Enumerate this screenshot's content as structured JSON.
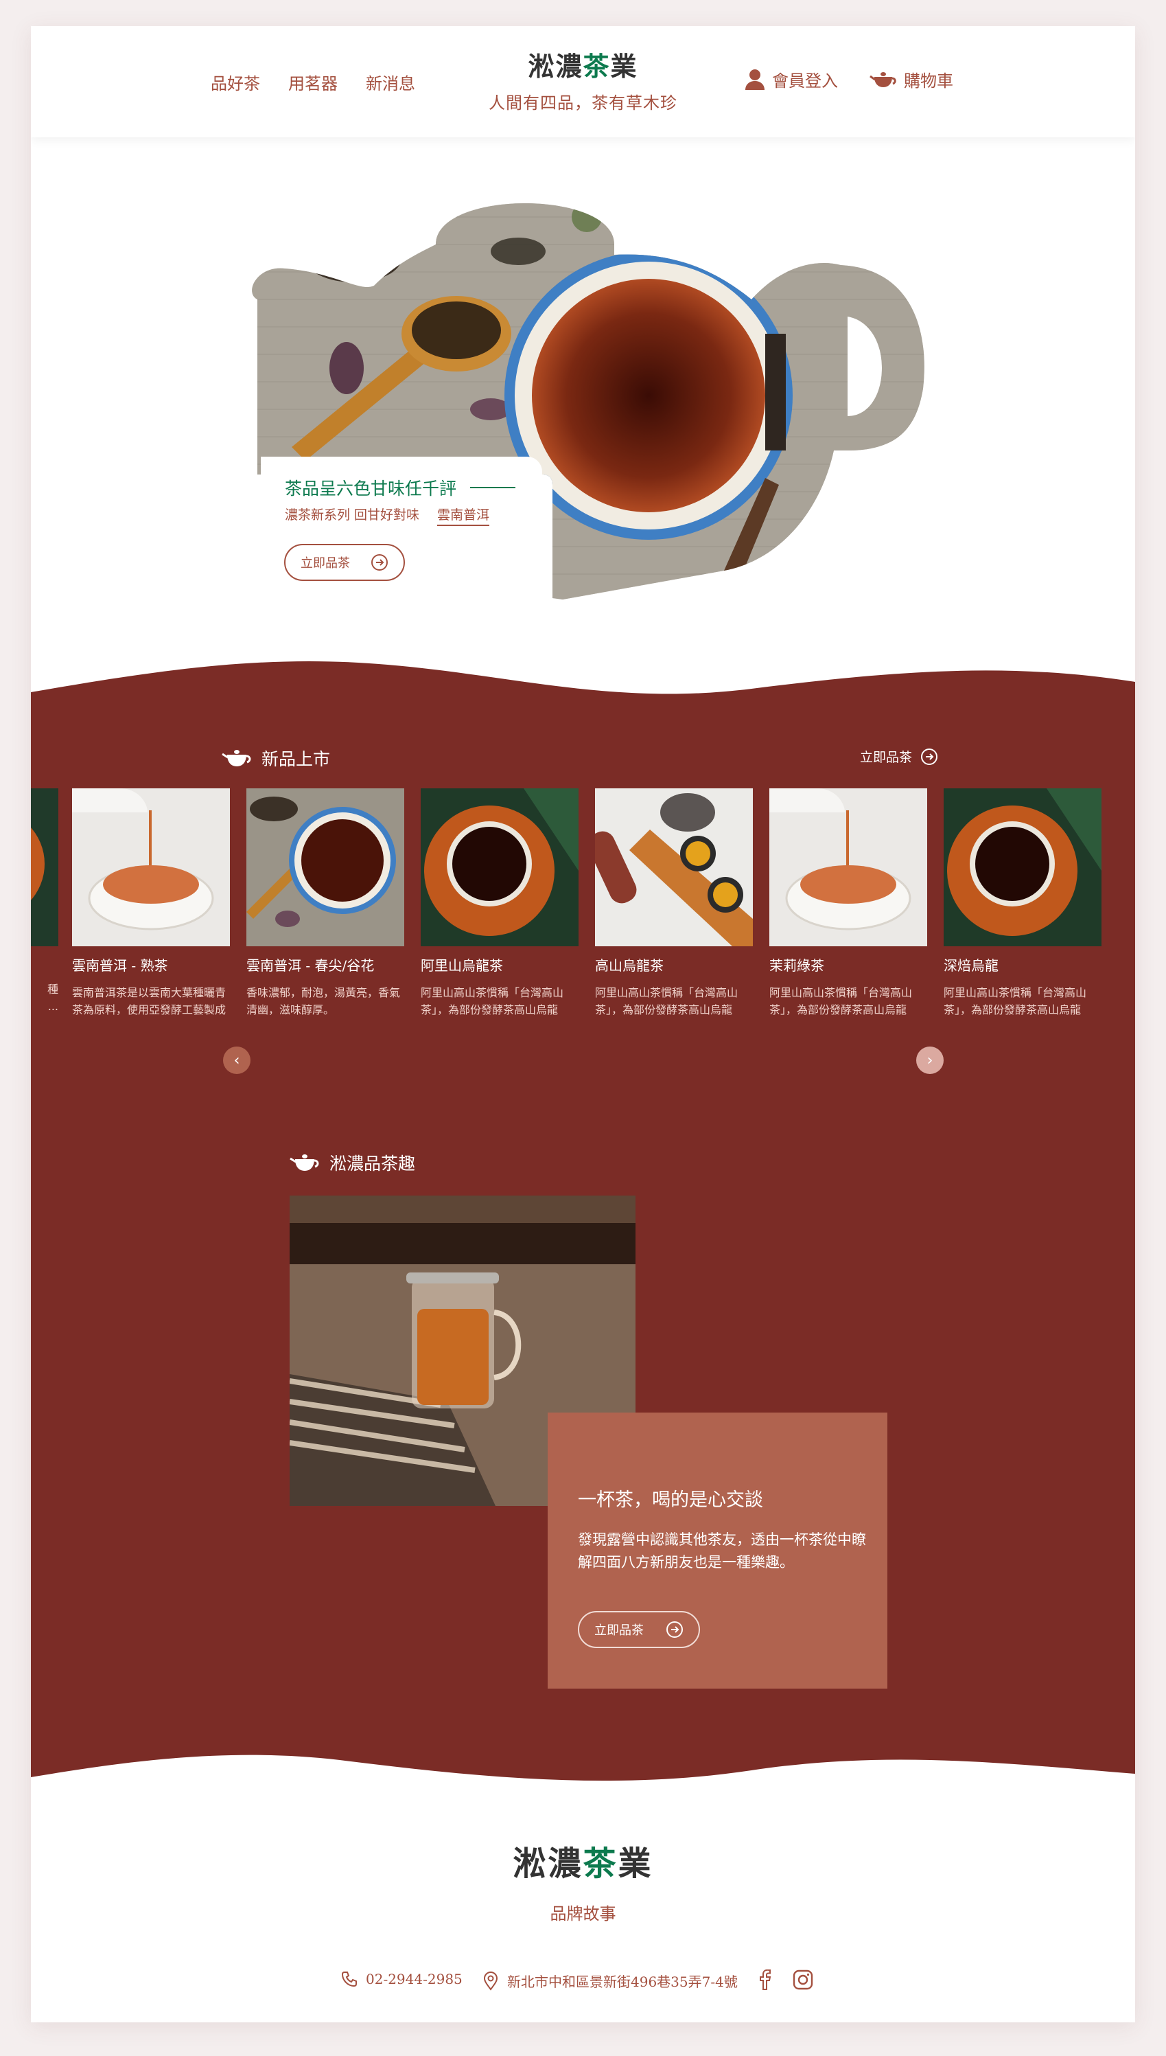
{
  "colors": {
    "maroon": "#7b2c26",
    "accent": "#a4503f",
    "green": "#0d7a4e",
    "card": "#b0634f"
  },
  "header": {
    "nav": [
      "品好茶",
      "用茗器",
      "新消息"
    ],
    "brand_a": "淞濃",
    "brand_b": "茶",
    "brand_c": "業",
    "tagline": "人間有四品，茶有草木珍",
    "login": "會員登入",
    "cart": "購物車",
    "login_icon": "user-icon",
    "cart_icon": "teapot-icon"
  },
  "hero": {
    "title": "茶品呈六色甘味任千評",
    "subtitle": "濃茶新系列 回甘好對味",
    "subtitle_link": "雲南普洱",
    "button": "立即品茶"
  },
  "new_arrivals": {
    "title": "新品上市",
    "more": "立即品茶",
    "products": [
      {
        "name": "雲南普洱 - 熟茶",
        "desc": "雲南普洱茶是以雲南大葉種曬青茶為原料，使用亞發酵工藝製成",
        "image": "milk-tea"
      },
      {
        "name": "雲南普洱 - 春尖/谷花",
        "desc": "香味濃郁，耐泡，湯黃亮，香氣清幽，滋味醇厚。",
        "image": "tea-cup-leaves"
      },
      {
        "name": "阿里山烏龍茶",
        "desc": "阿里山高山茶慣稱「台灣高山茶」，為部份發酵茶高山烏龍",
        "image": "tea-orange-plate"
      },
      {
        "name": "高山烏龍茶",
        "desc": "阿里山高山茶慣稱「台灣高山茶」，為部份發酵茶高山烏龍",
        "image": "teapot-tray"
      },
      {
        "name": "茉莉綠茶",
        "desc": "阿里山高山茶慣稱「台灣高山茶」，為部份發酵茶高山烏龍",
        "image": "milk-tea"
      },
      {
        "name": "深焙烏龍",
        "desc": "阿里山高山茶慣稱「台灣高山茶」，為部份發酵茶高山烏龍",
        "image": "tea-orange-plate"
      }
    ],
    "partial_left_desc": "種\n..."
  },
  "story": {
    "title": "淞濃品茶趣",
    "card_title": "一杯茶，喝的是心交談",
    "card_text": "發現露營中認識其他茶友，透由一杯茶從中瞭解四面八方新朋友也是一種樂趣。",
    "button": "立即品茶"
  },
  "footer": {
    "brand_a": "淞濃",
    "brand_b": "茶",
    "brand_c": "業",
    "story_link": "品牌故事",
    "phone": "02-2944-2985",
    "address": "新北市中和區景新街496巷35弄7-4號",
    "social": [
      "facebook-icon",
      "instagram-icon"
    ]
  }
}
